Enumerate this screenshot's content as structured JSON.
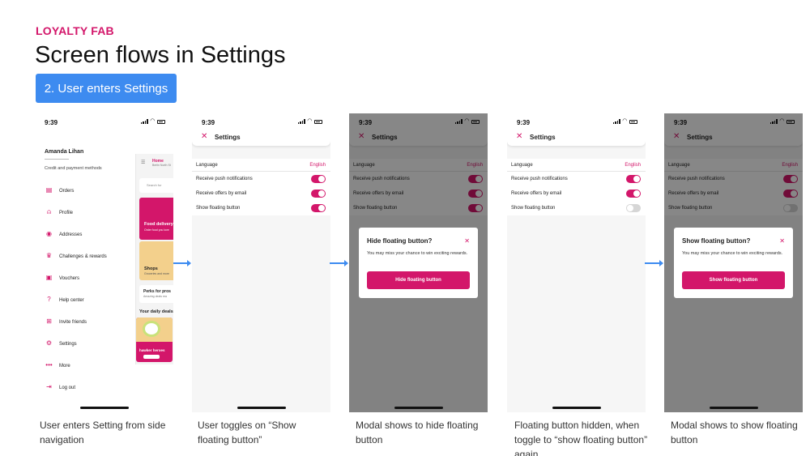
{
  "header": {
    "eyebrow": "LOYALTY FAB",
    "title": "Screen flows in Settings",
    "step_label": "2. User enters Settings"
  },
  "colors": {
    "brand": "#d3166a",
    "accent_blue": "#3d8bf0"
  },
  "status_time": "9:39",
  "nav_screen": {
    "user_name": "Amanda Lihan",
    "user_sub": "Credit and payment methods",
    "items": [
      {
        "label": "Orders",
        "icon": "receipt-icon"
      },
      {
        "label": "Profile",
        "icon": "person-icon"
      },
      {
        "label": "Addresses",
        "icon": "location-pin-icon"
      },
      {
        "label": "Challenges & rewards",
        "icon": "trophy-icon"
      },
      {
        "label": "Vouchers",
        "icon": "voucher-icon"
      },
      {
        "label": "Help center",
        "icon": "help-icon"
      },
      {
        "label": "Invite friends",
        "icon": "gift-icon"
      },
      {
        "label": "Settings",
        "icon": "gear-icon"
      },
      {
        "label": "More",
        "icon": "more-dots-icon"
      },
      {
        "label": "Log out",
        "icon": "logout-icon"
      }
    ],
    "peek": {
      "home_title": "Home",
      "home_sub": "Berlin North St",
      "search": "Search for",
      "food_title": "Food delivery",
      "food_sub": "Order food you love",
      "shops_title": "Shops",
      "shops_sub": "Groceries and more",
      "perks_title": "Perks for pros",
      "perks_sub": "Amazing deals rea",
      "deals_title": "Your daily deals",
      "hawker": "hawker heroes"
    }
  },
  "settings": {
    "title": "Settings",
    "language_label": "Language",
    "language_value": "English",
    "push_label": "Receive push notifications",
    "email_label": "Receive offers by email",
    "floating_label": "Show floating button"
  },
  "modal_hide": {
    "title": "Hide floating button?",
    "text": "You may miss your chance to win exciting rewards.",
    "button": "Hide floating button"
  },
  "modal_show": {
    "title": "Show floating button?",
    "text": "You may miss your chance to win exciting rewards.",
    "button": "Show floating button"
  },
  "captions": [
    "User enters Setting from side navigation",
    "User toggles on “Show floating button”",
    "Modal shows to hide floating button",
    "Floating button hidden, when toggle to “show floating button” again",
    "Modal shows to show floating button"
  ]
}
